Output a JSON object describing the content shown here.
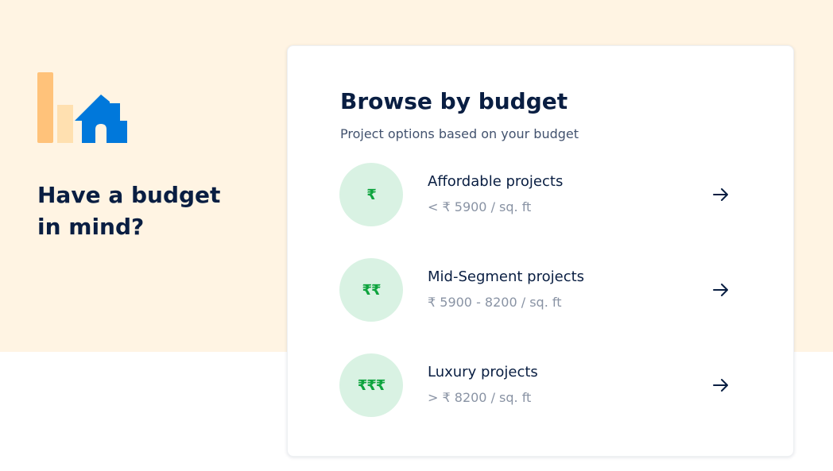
{
  "left": {
    "heading": "Have a budget in mind?",
    "graphic_icon": "budget-house-icon"
  },
  "card": {
    "title": "Browse by budget",
    "subtitle": "Project options based on your budget",
    "options": [
      {
        "symbol": "₹",
        "title": "Affordable projects",
        "range": "< ₹ 5900 / sq. ft",
        "arrow_icon": "arrow-right-icon"
      },
      {
        "symbol": "₹₹",
        "title": "Mid-Segment projects",
        "range": "₹ 5900 - 8200 / sq. ft",
        "arrow_icon": "arrow-right-icon"
      },
      {
        "symbol": "₹₹₹",
        "title": "Luxury projects",
        "range": "> ₹ 8200 / sq. ft",
        "arrow_icon": "arrow-right-icon"
      }
    ]
  },
  "colors": {
    "banner_bg": "#fff4e3",
    "heading": "#091e42",
    "circle_bg": "#d9f2e3",
    "rupee_green": "#0ea43e",
    "house_blue": "#0078db",
    "bar_orange": "#ffc27a",
    "bar_light": "#ffe0b0"
  }
}
